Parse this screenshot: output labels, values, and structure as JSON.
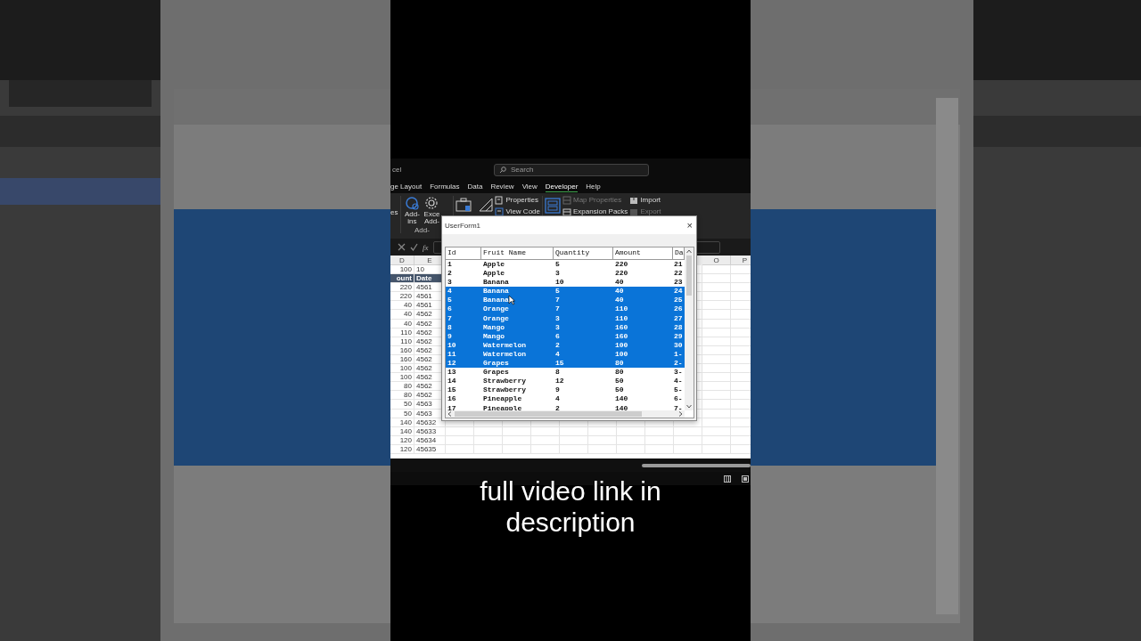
{
  "excel": {
    "title": "cel",
    "search": {
      "placeholder": "Search"
    },
    "ribbon_tabs": [
      {
        "label": "ge Layout",
        "selected": false
      },
      {
        "label": "Formulas",
        "selected": false
      },
      {
        "label": "Data",
        "selected": false
      },
      {
        "label": "Review",
        "selected": false
      },
      {
        "label": "View",
        "selected": false
      },
      {
        "label": "Developer",
        "selected": true
      },
      {
        "label": "Help",
        "selected": false
      }
    ],
    "ribbon_left": "es",
    "large_buttons": [
      {
        "label": "Add-ins",
        "kind": "addins"
      },
      {
        "label": "Exce Add-",
        "kind": "gear"
      }
    ],
    "group_label": "Add-",
    "small_buttons": [
      {
        "label": "Properties",
        "kind": "properties",
        "disabled": false
      },
      {
        "label": "View Code",
        "kind": "code",
        "disabled": false
      },
      {
        "label": "Map Properties",
        "kind": "map",
        "disabled": true
      },
      {
        "label": "Expansion Packs",
        "kind": "packs",
        "disabled": false
      },
      {
        "label": "Import",
        "kind": "import",
        "disabled": false
      },
      {
        "label": "Export",
        "kind": "export",
        "disabled": true
      }
    ],
    "function_label": "fx",
    "column_letters": [
      "D",
      "E",
      "O",
      "P"
    ],
    "rows": [
      {
        "kind": "data",
        "cells": [
          "100",
          "10"
        ]
      },
      {
        "kind": "header",
        "cells": [
          "ount",
          "Date"
        ]
      },
      {
        "kind": "data",
        "cells": [
          "220",
          "4561"
        ]
      },
      {
        "kind": "data",
        "cells": [
          "220",
          "4561"
        ]
      },
      {
        "kind": "data",
        "cells": [
          "40",
          "4561"
        ]
      },
      {
        "kind": "data",
        "cells": [
          "40",
          "4562"
        ]
      },
      {
        "kind": "data",
        "cells": [
          "40",
          "4562"
        ]
      },
      {
        "kind": "data",
        "cells": [
          "110",
          "4562"
        ]
      },
      {
        "kind": "data",
        "cells": [
          "110",
          "4562"
        ]
      },
      {
        "kind": "data",
        "cells": [
          "160",
          "4562"
        ]
      },
      {
        "kind": "data",
        "cells": [
          "160",
          "4562"
        ]
      },
      {
        "kind": "data",
        "cells": [
          "100",
          "4562"
        ]
      },
      {
        "kind": "data",
        "cells": [
          "100",
          "4562"
        ]
      },
      {
        "kind": "data",
        "cells": [
          "80",
          "4562"
        ]
      },
      {
        "kind": "data",
        "cells": [
          "80",
          "4562"
        ]
      },
      {
        "kind": "data",
        "cells": [
          "50",
          "4563"
        ]
      },
      {
        "kind": "data",
        "cells": [
          "50",
          "4563"
        ]
      },
      {
        "kind": "data",
        "cells": [
          "140",
          "45632"
        ]
      },
      {
        "kind": "data",
        "cells": [
          "140",
          "45633"
        ]
      },
      {
        "kind": "data",
        "cells": [
          "120",
          "45634"
        ]
      },
      {
        "kind": "data",
        "cells": [
          "120",
          "45635"
        ]
      }
    ]
  },
  "userform": {
    "title": "UserForm1",
    "close": "×",
    "columns": [
      "Id",
      "Fruit Name",
      "Quantity",
      "Amount",
      "Da"
    ],
    "rows": [
      {
        "cells": [
          "1",
          "Apple",
          "5",
          "220",
          "21"
        ],
        "selected": false
      },
      {
        "cells": [
          "2",
          "Apple",
          "3",
          "220",
          "22"
        ],
        "selected": false
      },
      {
        "cells": [
          "3",
          "Banana",
          "10",
          "40",
          "23"
        ],
        "selected": false
      },
      {
        "cells": [
          "4",
          "Banana",
          "5",
          "40",
          "24"
        ],
        "selected": true
      },
      {
        "cells": [
          "5",
          "Banana",
          "7",
          "40",
          "25"
        ],
        "selected": true
      },
      {
        "cells": [
          "6",
          "Orange",
          "7",
          "110",
          "26"
        ],
        "selected": true
      },
      {
        "cells": [
          "7",
          "Orange",
          "3",
          "110",
          "27"
        ],
        "selected": true
      },
      {
        "cells": [
          "8",
          "Mango",
          "3",
          "160",
          "28"
        ],
        "selected": true
      },
      {
        "cells": [
          "9",
          "Mango",
          "6",
          "160",
          "29"
        ],
        "selected": true
      },
      {
        "cells": [
          "10",
          "Watermelon",
          "2",
          "100",
          "30"
        ],
        "selected": true
      },
      {
        "cells": [
          "11",
          "Watermelon",
          "4",
          "100",
          "1-"
        ],
        "selected": true
      },
      {
        "cells": [
          "12",
          "Grapes",
          "15",
          "80",
          "2-"
        ],
        "selected": true
      },
      {
        "cells": [
          "13",
          "Grapes",
          "8",
          "80",
          "3-"
        ],
        "selected": false
      },
      {
        "cells": [
          "14",
          "Strawberry",
          "12",
          "50",
          "4-"
        ],
        "selected": false
      },
      {
        "cells": [
          "15",
          "Strawberry",
          "9",
          "50",
          "5-"
        ],
        "selected": false
      },
      {
        "cells": [
          "16",
          "Pineapple",
          "4",
          "140",
          "6-"
        ],
        "selected": false
      },
      {
        "cells": [
          "17",
          "Pineapple",
          "2",
          "140",
          "7-"
        ],
        "selected": false
      }
    ]
  },
  "caption": "full video link in description"
}
